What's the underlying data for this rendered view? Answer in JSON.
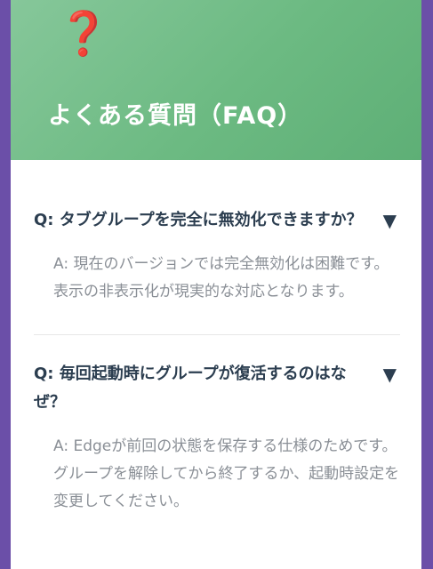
{
  "header": {
    "icon": "❓",
    "icon_name": "question-mark-icon",
    "title": "よくある質問（FAQ）"
  },
  "faq": [
    {
      "question": "Q: タブグループを完全に無効化できますか？",
      "toggle": "▼",
      "answer": "A: 現在のバージョンでは完全無効化は困難です。表示の非表示化が現実的な対応となります。"
    },
    {
      "question": "Q: 毎回起動時にグループが復活するのはなぜ？",
      "toggle": "▼",
      "answer": "A: Edgeが前回の状態を保存する仕様のためです。グループを解除してから終了するか、起動時設定を変更してください。"
    }
  ],
  "colors": {
    "frame": "#6b4fa8",
    "header_gradient_start": "#86c79a",
    "header_gradient_end": "#5eaf76",
    "question_text": "#2c3e50",
    "answer_text": "#8a8f96",
    "icon": "#d61f1f"
  }
}
